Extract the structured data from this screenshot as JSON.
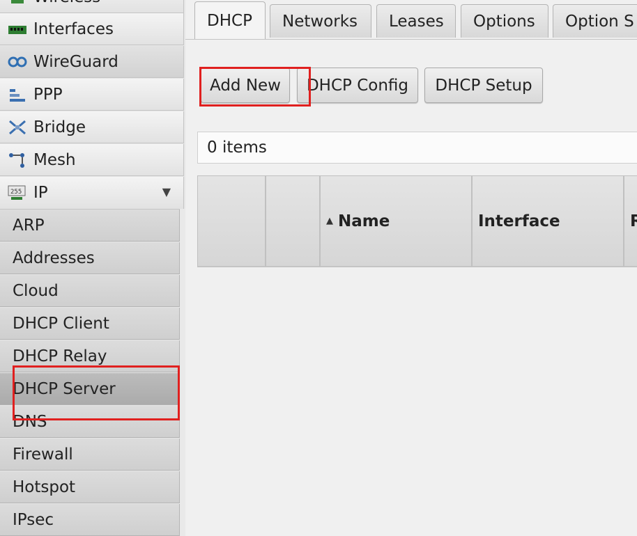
{
  "sidebar": {
    "top_items": [
      {
        "label": "Wireless",
        "icon": "wireless-icon"
      },
      {
        "label": "Interfaces",
        "icon": "interfaces-icon"
      },
      {
        "label": "WireGuard",
        "icon": "wireguard-icon"
      },
      {
        "label": "PPP",
        "icon": "ppp-icon"
      },
      {
        "label": "Bridge",
        "icon": "bridge-icon"
      },
      {
        "label": "Mesh",
        "icon": "mesh-icon"
      },
      {
        "label": "IP",
        "icon": "ip-icon",
        "chevron": "▼"
      }
    ],
    "ip_subitems": [
      {
        "label": "ARP"
      },
      {
        "label": "Addresses"
      },
      {
        "label": "Cloud"
      },
      {
        "label": "DHCP Client"
      },
      {
        "label": "DHCP Relay"
      },
      {
        "label": "DHCP Server",
        "selected": true
      },
      {
        "label": "DNS"
      },
      {
        "label": "Firewall"
      },
      {
        "label": "Hotspot"
      },
      {
        "label": "IPsec"
      }
    ]
  },
  "tabs": [
    {
      "label": "DHCP",
      "active": true
    },
    {
      "label": "Networks"
    },
    {
      "label": "Leases"
    },
    {
      "label": "Options"
    },
    {
      "label": "Option S"
    }
  ],
  "toolbar": {
    "add_new": "Add New",
    "dhcp_config": "DHCP Config",
    "dhcp_setup": "DHCP Setup"
  },
  "items_count": "0 items",
  "table": {
    "columns": [
      "",
      "",
      "Name",
      "Interface",
      "R"
    ],
    "sort_indicator": "▲"
  },
  "colors": {
    "highlight": "#e0201f"
  }
}
